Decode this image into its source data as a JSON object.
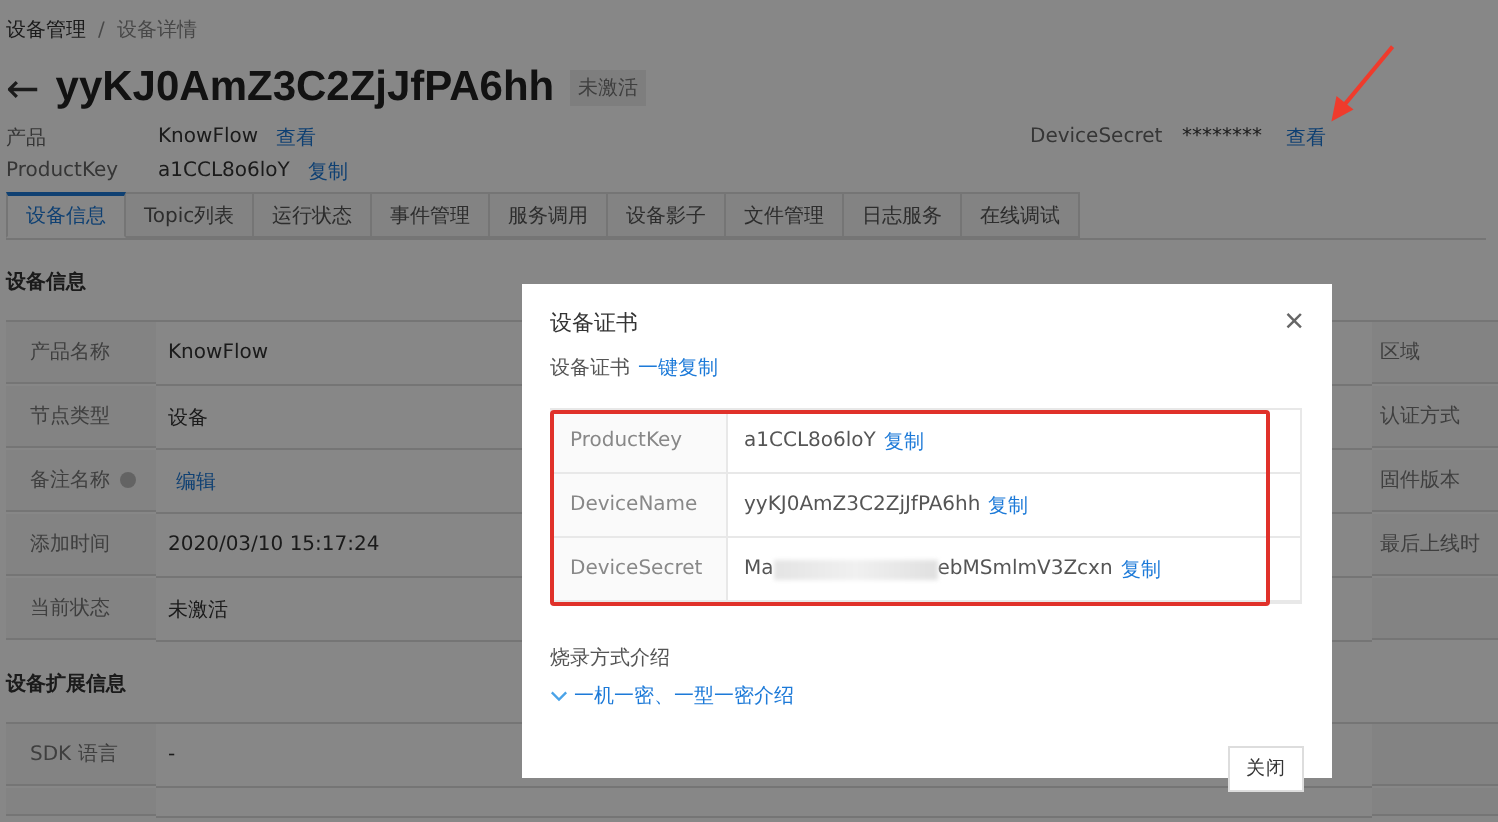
{
  "breadcrumb": {
    "items": [
      "设备管理",
      "设备详情"
    ],
    "separator": "/"
  },
  "device": {
    "back": "←",
    "name": "yyKJ0AmZ3C2ZjJfPA6hh",
    "status": "未激活"
  },
  "meta": [
    {
      "label": "产品",
      "value": "KnowFlow",
      "link": "查看"
    },
    {
      "label": "ProductKey",
      "value": "a1CCL8o6loY",
      "link": "复制"
    }
  ],
  "secret": {
    "label": "DeviceSecret",
    "value": "********",
    "link": "查看"
  },
  "tabs": [
    {
      "label": "设备信息",
      "selected": true
    },
    {
      "label": "Topic列表",
      "selected": false
    },
    {
      "label": "运行状态",
      "selected": false
    },
    {
      "label": "事件管理",
      "selected": false
    },
    {
      "label": "服务调用",
      "selected": false
    },
    {
      "label": "设备影子",
      "selected": false
    },
    {
      "label": "文件管理",
      "selected": false
    },
    {
      "label": "日志服务",
      "selected": false
    },
    {
      "label": "在线调试",
      "selected": false
    }
  ],
  "info": {
    "title": "设备信息",
    "rows": [
      {
        "label": "产品名称",
        "value": "KnowFlow",
        "kind": "text",
        "help": false,
        "label_2": "区域"
      },
      {
        "label": "节点类型",
        "value": "设备",
        "kind": "text",
        "help": false,
        "label_2": "认证方式"
      },
      {
        "label": "备注名称",
        "value": "编辑",
        "kind": "link",
        "help": true,
        "label_2": "固件版本"
      },
      {
        "label": "添加时间",
        "value": "2020/03/10 15:17:24",
        "kind": "text",
        "help": false,
        "label_2": "最后上线时"
      },
      {
        "label": "当前状态",
        "value": "未激活",
        "kind": "text",
        "help": false
      }
    ]
  },
  "ext": {
    "title": "设备扩展信息",
    "rows": [
      {
        "label": "SDK 语言",
        "value": "-"
      }
    ]
  },
  "dialog": {
    "title": "设备证书",
    "close": "×",
    "subtitle": "设备证书",
    "copy_all": "一键复制",
    "rows": [
      {
        "label": "ProductKey",
        "value": "a1CCL8o6loY",
        "redacted": false,
        "action": "复制"
      },
      {
        "label": "DeviceName",
        "value": "yyKJ0AmZ3C2ZjJfPA6hh",
        "redacted": false,
        "action": "复制"
      },
      {
        "label": "DeviceSecret",
        "value": "Ma",
        "value_end": "ebMSmlmV3Zcxn",
        "redacted": true,
        "action": "复制"
      }
    ],
    "section": "烧录方式介绍",
    "expand_link": "一机一密、一型一密介绍",
    "close_button": "关闭"
  },
  "annotations": {
    "highlight_box": true,
    "arrow": true
  }
}
